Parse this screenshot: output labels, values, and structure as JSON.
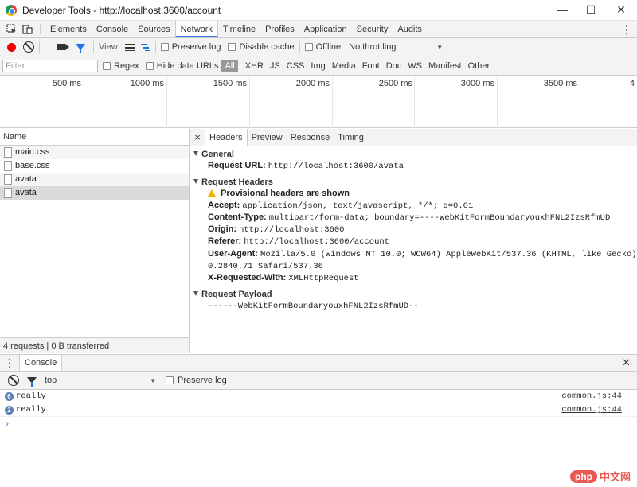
{
  "window": {
    "title": "Developer Tools - http://localhost:3600/account",
    "minimize": "—",
    "maximize": "☐",
    "close": "✕"
  },
  "tabs": [
    "Elements",
    "Console",
    "Sources",
    "Network",
    "Timeline",
    "Profiles",
    "Application",
    "Security",
    "Audits"
  ],
  "active_tab": "Network",
  "network_toolbar": {
    "view_label": "View:",
    "preserve_log": "Preserve log",
    "disable_cache": "Disable cache",
    "offline": "Offline",
    "throttling": "No throttling"
  },
  "filter": {
    "placeholder": "Filter",
    "regex": "Regex",
    "hide_data_urls": "Hide data URLs",
    "types": [
      "All",
      "XHR",
      "JS",
      "CSS",
      "Img",
      "Media",
      "Font",
      "Doc",
      "WS",
      "Manifest",
      "Other"
    ]
  },
  "overview": {
    "ticks": [
      "500 ms",
      "1000 ms",
      "1500 ms",
      "2000 ms",
      "2500 ms",
      "3000 ms",
      "3500 ms",
      "4"
    ]
  },
  "request_list": {
    "header": "Name",
    "rows": [
      "main.css",
      "base.css",
      "avata",
      "avata"
    ],
    "selected_index": 3,
    "footer": "4 requests | 0 B transferred"
  },
  "detail": {
    "close": "×",
    "tabs": [
      "Headers",
      "Preview",
      "Response",
      "Timing"
    ],
    "active_tab": "Headers",
    "general": {
      "title": "General",
      "request_url_key": "Request URL:",
      "request_url_val": "http://localhost:3600/avata"
    },
    "request_headers": {
      "title": "Request Headers",
      "warning": "Provisional headers are shown",
      "accept_key": "Accept:",
      "accept_val": "application/json, text/javascript, */*; q=0.01",
      "content_type_key": "Content-Type:",
      "content_type_val": "multipart/form-data; boundary=----WebKitFormBoundaryouxhFNL2IzsRfmUD",
      "origin_key": "Origin:",
      "origin_val": "http://localhost:3600",
      "referer_key": "Referer:",
      "referer_val": "http://localhost:3600/account",
      "user_agent_key": "User-Agent:",
      "user_agent_val1": "Mozilla/5.0 (Windows NT 10.0; WOW64) AppleWebKit/537.36 (KHTML, like Gecko) Chrome/54.",
      "user_agent_val2": "0.2840.71 Safari/537.36",
      "xrw_key": "X-Requested-With:",
      "xrw_val": "XMLHttpRequest"
    },
    "payload": {
      "title": "Request Payload",
      "value": "------WebKitFormBoundaryouxhFNL2IzsRfmUD--"
    }
  },
  "drawer": {
    "tab": "Console",
    "close": "✕",
    "context": "top",
    "preserve_log": "Preserve log",
    "messages": [
      {
        "count": "6",
        "text": "really",
        "source": "common.js:44"
      },
      {
        "count": "2",
        "text": "really",
        "source": "common.js:44"
      }
    ],
    "prompt": "›"
  },
  "watermark": {
    "badge": "php",
    "text": "中文网"
  },
  "colors": {
    "accent": "#3879d9",
    "record": "#ee0000",
    "badge": "#5a7fb5"
  }
}
